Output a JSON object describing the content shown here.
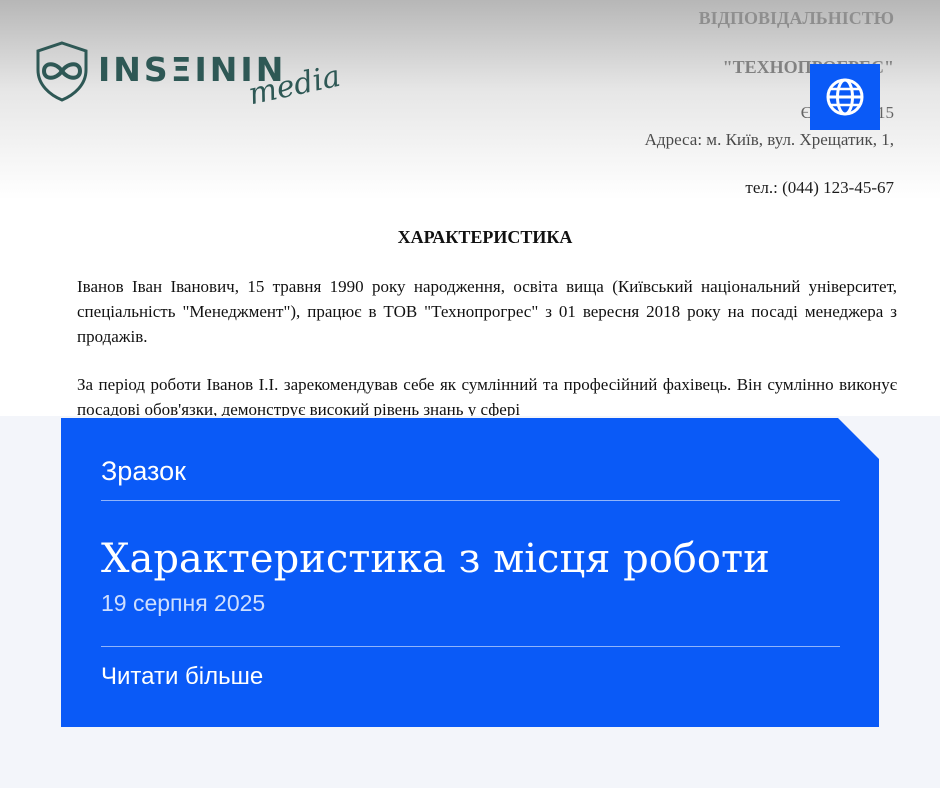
{
  "document": {
    "org_line1": "ВІДПОВІДАЛЬНІСТЮ",
    "org_line2": "\"ТЕХНОПРОГРЕС\"",
    "edrpou": "ЄДРПОУ: 15",
    "address": "Адреса: м. Київ, вул. Хрещатик, 1,",
    "phone": "тел.: (044) 123-45-67",
    "title": "ХАРАКТЕРИСТИКА",
    "paragraph1": "Іванов Іван Іванович, 15 травня 1990 року народження, освіта вища (Київський національний університет, спеціальність \"Менеджмент\"), працює в ТОВ \"Технопрогрес\" з 01 вересня 2018 року на посаді менеджера з продажів.",
    "paragraph2": "За період роботи Іванов І.І. зарекомендував себе як сумлінний та професійний фахівець. Він сумлінно виконує посадові обов'язки, демонструє високий рівень знань у сфері"
  },
  "logo": {
    "brand": "INSΞININ",
    "sub": "media"
  },
  "globe_button": {
    "icon": "globe-icon"
  },
  "card": {
    "category": "Зразок",
    "headline": "Характеристика з місця роботи",
    "date": "19 серпня 2025",
    "read_more": "Читати більше"
  },
  "colors": {
    "accent": "#0a5af7",
    "logo": "#2e5855",
    "page_bg": "#f3f5fa"
  }
}
